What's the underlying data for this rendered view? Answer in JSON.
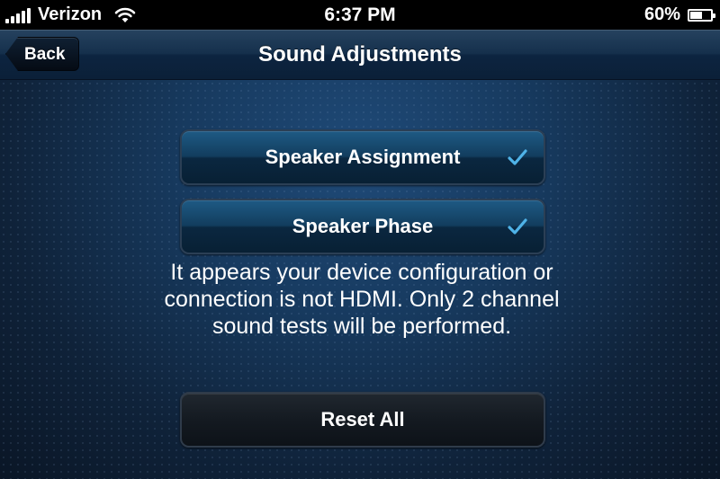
{
  "status_bar": {
    "carrier": "Verizon",
    "time": "6:37 PM",
    "battery_percent": "60%",
    "battery_level": 0.6,
    "signal_bars": 5,
    "icons": [
      "signal-icon",
      "wifi-icon",
      "battery-icon"
    ]
  },
  "nav": {
    "back_label": "Back",
    "title": "Sound Adjustments"
  },
  "options": [
    {
      "label": "Speaker Assignment",
      "checked": true,
      "icon": "checkmark-icon"
    },
    {
      "label": "Speaker Phase",
      "checked": true,
      "icon": "checkmark-icon"
    }
  ],
  "info_text": "It appears your device configuration or connection is not HDMI. Only 2 channel sound tests will be performed.",
  "reset_label": "Reset All",
  "colors": {
    "checkmark": "#4fb3e8",
    "nav_bar": "#15304c",
    "background": "#132b46",
    "option_button": "#123d5e",
    "reset_button": "#141a21"
  }
}
